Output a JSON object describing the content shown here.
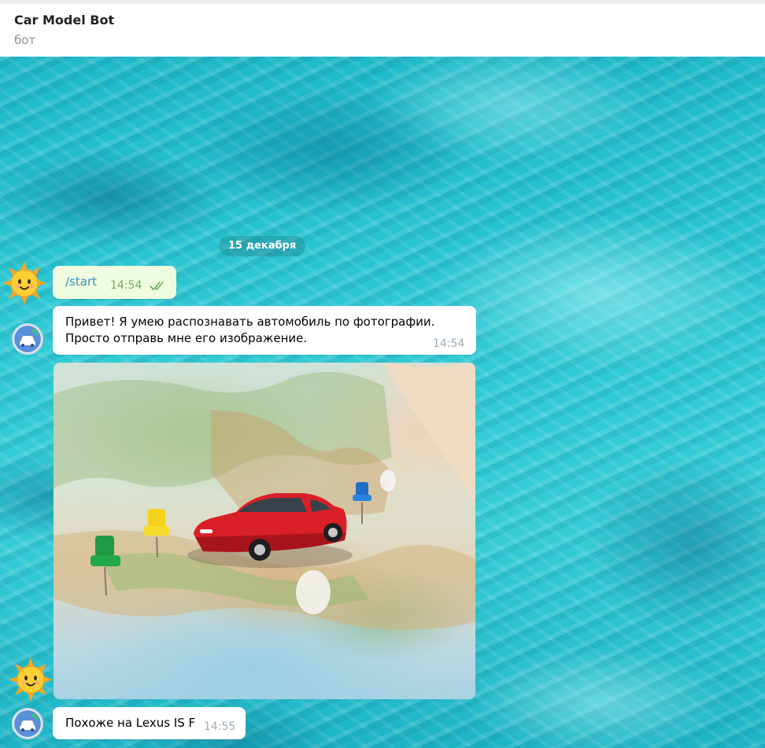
{
  "chat": {
    "title": "Car Model Bot",
    "subtitle": "бот"
  },
  "date_divider": "15 декабря",
  "messages": [
    {
      "direction": "out",
      "text": "/start",
      "time": "14:54",
      "status": "read"
    },
    {
      "direction": "in",
      "lines": [
        "Привет! Я умею распознавать автомобиль по фотографии.",
        "Просто отправь мне его изображение."
      ],
      "time": "14:54"
    },
    {
      "direction": "out",
      "type": "photo",
      "subject": "red toy car on a map with push pins"
    },
    {
      "direction": "in",
      "text": "Похоже на Lexus IS F",
      "time": "14:55"
    }
  ],
  "colors": {
    "outgoing_bubble": "#effdde",
    "incoming_bubble": "#ffffff",
    "link": "#3a8fc8",
    "read_ticks": "#6cae5e"
  },
  "icons": {
    "user_avatar": "sun-emoji-icon",
    "bot_avatar": "car-bot-icon",
    "read_status": "double-check-icon"
  }
}
